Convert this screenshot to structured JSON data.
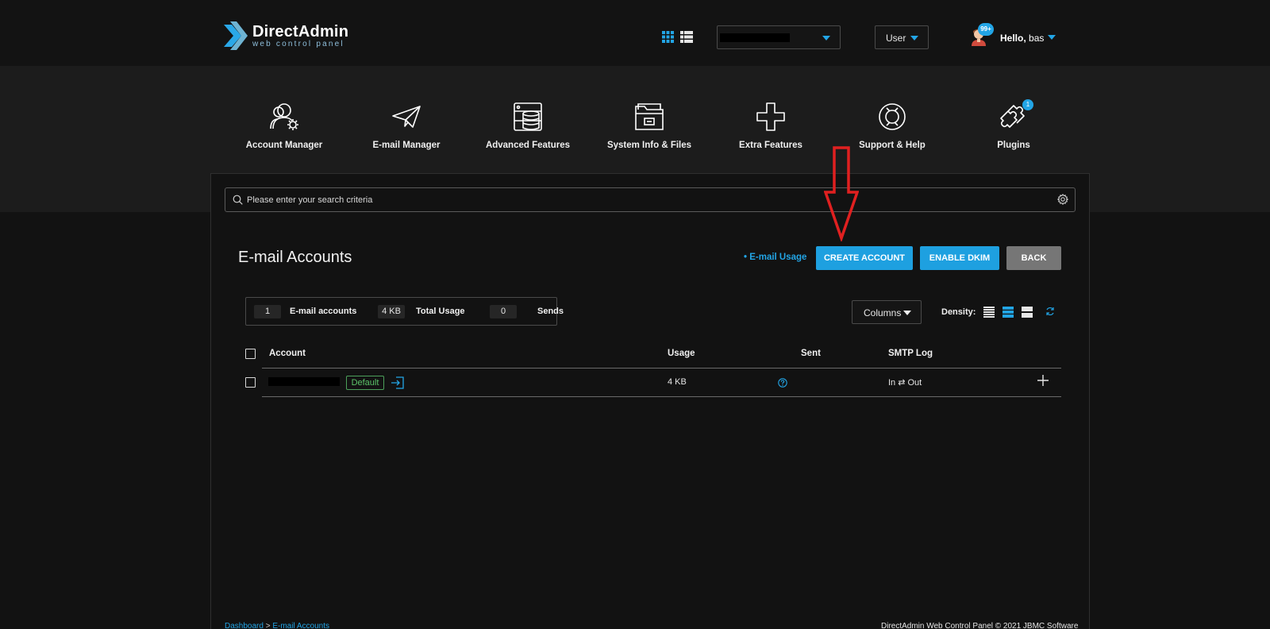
{
  "header": {
    "logo_name": "DirectAdmin",
    "logo_sub": "web control panel",
    "user_menu": "User",
    "notifications": "99+",
    "hello": "Hello,",
    "username": "bas",
    "icons": [
      "grid-view-icon",
      "list-view-icon",
      "avatar-icon"
    ]
  },
  "nav": {
    "items": [
      {
        "label": "Account Manager",
        "icon": "account-manager-icon"
      },
      {
        "label": "E-mail Manager",
        "icon": "paper-plane-icon"
      },
      {
        "label": "Advanced Features",
        "icon": "server-database-icon"
      },
      {
        "label": "System Info & Files",
        "icon": "folder-icon"
      },
      {
        "label": "Extra Features",
        "icon": "plus-icon"
      },
      {
        "label": "Support & Help",
        "icon": "lifebuoy-icon"
      },
      {
        "label": "Plugins",
        "icon": "puzzle-icon"
      }
    ],
    "plugins_badge": "1"
  },
  "search": {
    "placeholder": "Please enter your search criteria"
  },
  "page": {
    "title": "E-mail Accounts",
    "usage_link": "• E-mail Usage",
    "buttons": {
      "create": "CREATE ACCOUNT",
      "dkim": "ENABLE DKIM",
      "back": "BACK"
    }
  },
  "stats": [
    {
      "value": "1",
      "label": "E-mail accounts"
    },
    {
      "value": "4 KB",
      "label": "Total Usage"
    },
    {
      "value": "0",
      "label": "Sends"
    }
  ],
  "toolbar": {
    "columns": "Columns",
    "density": "Density:"
  },
  "table": {
    "headers": [
      "Account",
      "Usage",
      "Sent",
      "SMTP Log"
    ],
    "rows": [
      {
        "badge": "Default",
        "usage": "4 KB",
        "smtp_log": "In ⇄ Out"
      }
    ]
  },
  "footer": {
    "breadcrumb_home": "Dashboard",
    "breadcrumb_sep": ">",
    "breadcrumb_current": "E-mail Accounts",
    "copyright": "DirectAdmin Web Control Panel © 2021 JBMC Software"
  },
  "colors": {
    "accent": "#22a5e6",
    "background": "#121212",
    "annotation_arrow": "#e02020"
  }
}
